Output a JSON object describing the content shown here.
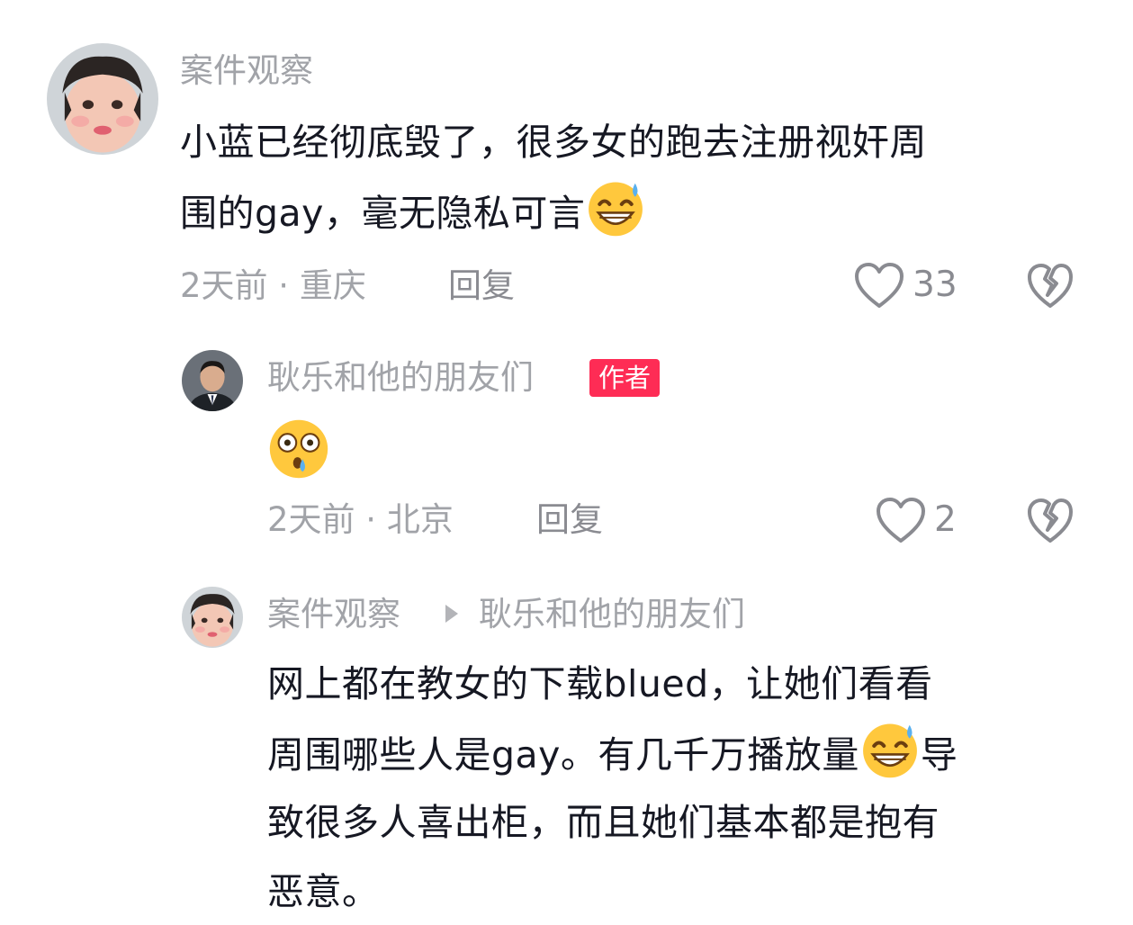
{
  "comments": [
    {
      "username": "案件观察",
      "text_lines": [
        "小蓝已经彻底毁了，很多女的跑去注册视奸周",
        "围的gay，毫无隐私可言"
      ],
      "emoji": "grinning-sweat-emoji",
      "meta": "2天前 · 重庆",
      "reply_label": "回复",
      "like_count": "33"
    },
    {
      "username": "耿乐和他的朋友们",
      "badge": "作者",
      "emoji": "shocked-face-emoji",
      "meta": "2天前 · 北京",
      "reply_label": "回复",
      "like_count": "2"
    },
    {
      "username": "案件观察",
      "reply_to": "耿乐和他的朋友们",
      "text_lines": [
        "网上都在教女的下载blued，让她们看看",
        "周围哪些人是gay。有几千万播放量",
        "导",
        "致很多人喜出柜，而且她们基本都是抱有",
        "恶意。"
      ]
    }
  ],
  "colors": {
    "username": "#a1a3a8",
    "badge_bg": "#fe2c55",
    "text": "#161823"
  },
  "icons": [
    "heart-outline-icon",
    "broken-heart-icon",
    "play-arrow-icon"
  ]
}
